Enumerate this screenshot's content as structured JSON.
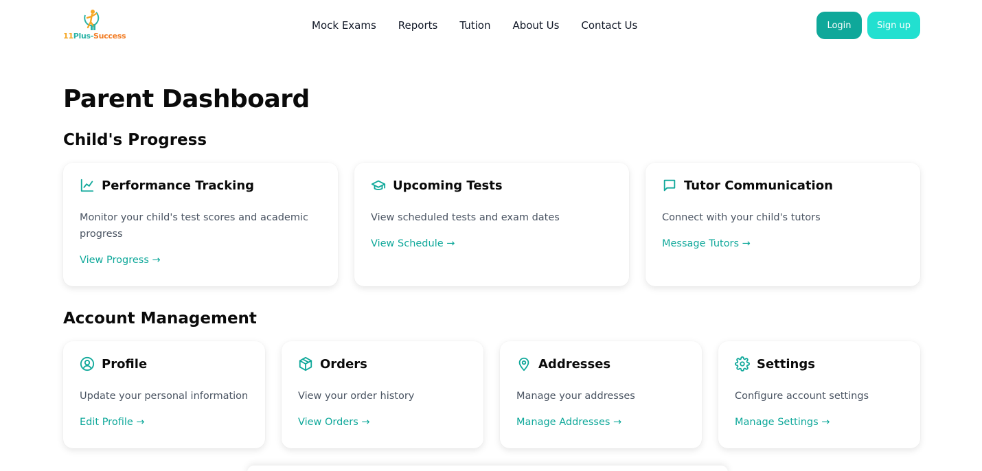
{
  "header": {
    "logo": {
      "part1": "11",
      "part2": "Plus-",
      "part3": "Success"
    },
    "nav": [
      "Mock Exams",
      "Reports",
      "Tution",
      "About Us",
      "Contact Us"
    ],
    "login_label": "Login",
    "signup_label": "Sign up"
  },
  "page_title": "Parent Dashboard",
  "progress": {
    "title": "Child's Progress",
    "cards": [
      {
        "icon": "chart-line-icon",
        "title": "Performance Tracking",
        "desc": "Monitor your child's test scores and academic progress",
        "link": "View Progress →"
      },
      {
        "icon": "graduation-cap-icon",
        "title": "Upcoming Tests",
        "desc": "View scheduled tests and exam dates",
        "link": "View Schedule →"
      },
      {
        "icon": "chat-bubble-icon",
        "title": "Tutor Communication",
        "desc": "Connect with your child's tutors",
        "link": "Message Tutors →"
      }
    ]
  },
  "account": {
    "title": "Account Management",
    "cards": [
      {
        "icon": "user-circle-icon",
        "title": "Profile",
        "desc": "Update your personal information",
        "link": "Edit Profile →"
      },
      {
        "icon": "package-icon",
        "title": "Orders",
        "desc": "View your order history",
        "link": "View Orders →"
      },
      {
        "icon": "map-pin-icon",
        "title": "Addresses",
        "desc": "Manage your addresses",
        "link": "Manage Addresses →"
      },
      {
        "icon": "gear-icon",
        "title": "Settings",
        "desc": "Configure account settings",
        "link": "Manage Settings →"
      }
    ]
  },
  "colors": {
    "accent": "#0fa89a",
    "signup": "#22e0d0",
    "text_dark": "#0a0a0a",
    "text_muted": "#4b5563"
  }
}
